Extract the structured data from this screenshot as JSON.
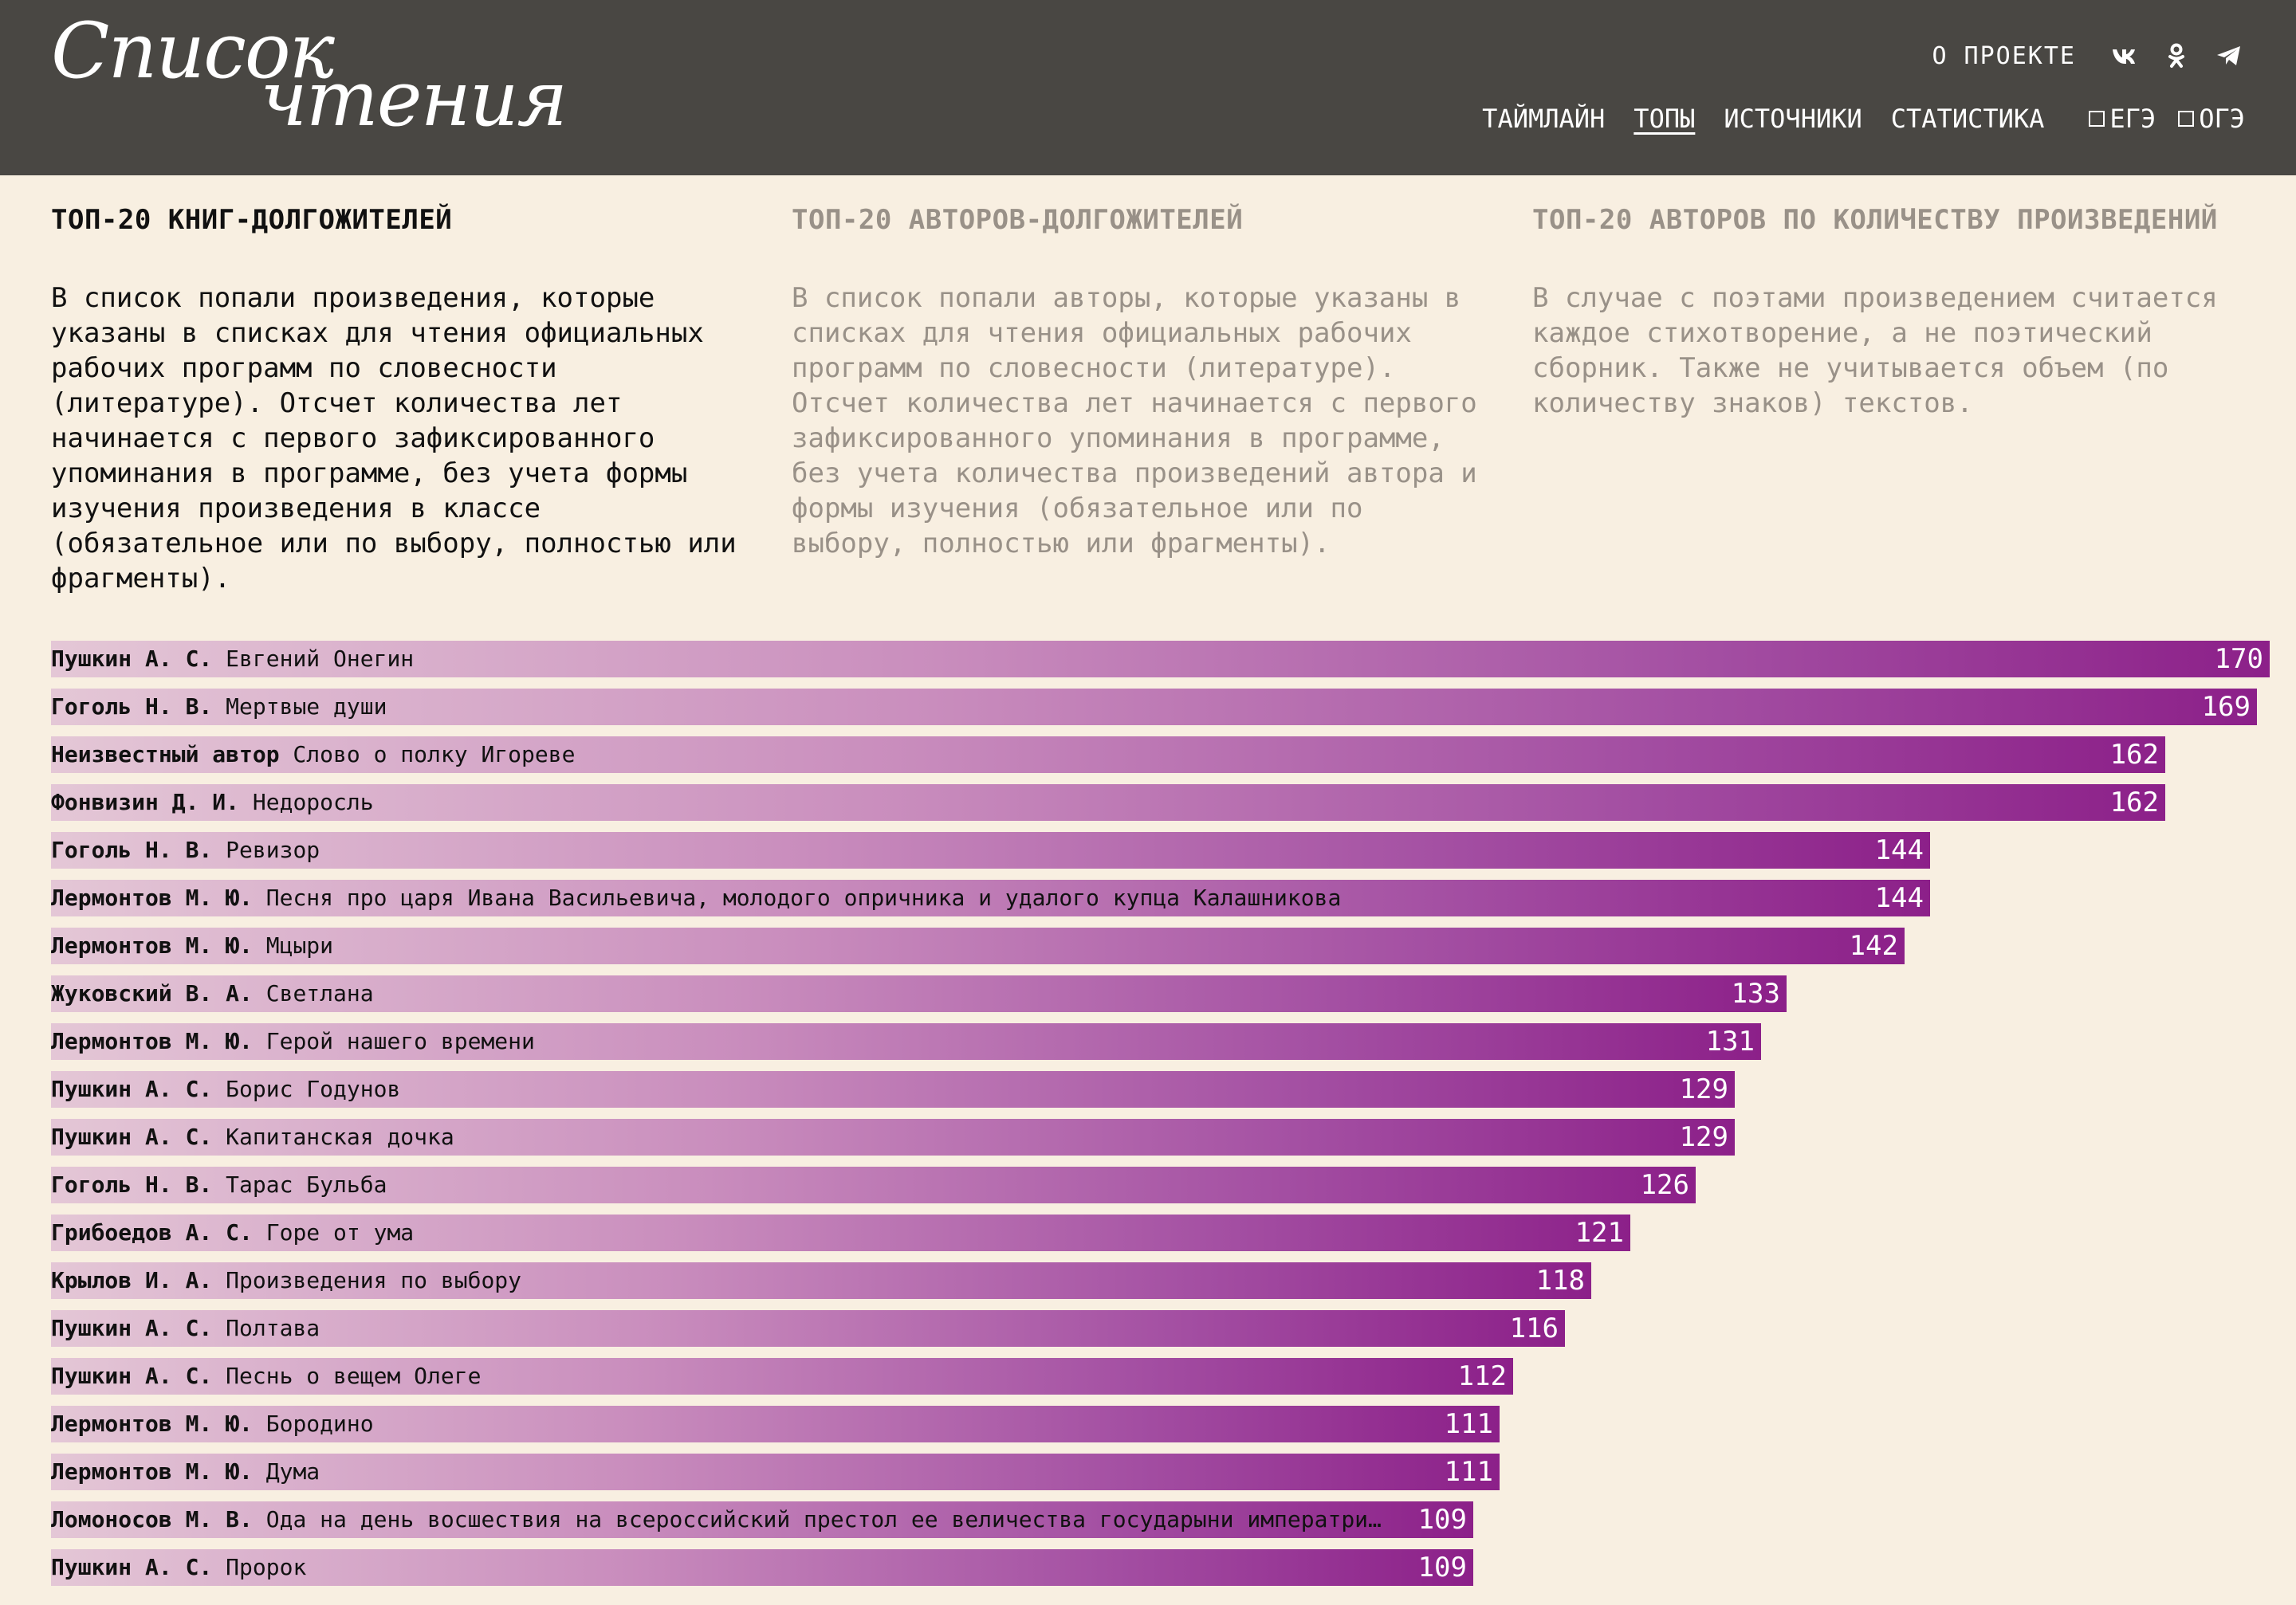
{
  "header": {
    "logo_line1": "Список",
    "logo_line2": "чтения",
    "about": "О ПРОЕКТЕ",
    "social": [
      "vk-icon",
      "ok-icon",
      "telegram-icon"
    ],
    "nav": [
      "ТАЙМЛАЙН",
      "ТОПЫ",
      "ИСТОЧНИКИ",
      "СТАТИСТИКА"
    ],
    "active_nav": "ТОПЫ",
    "filters": [
      "ЕГЭ",
      "ОГЭ"
    ]
  },
  "tabs": [
    {
      "title": "ТОП-20 КНИГ-ДОЛГОЖИТЕЛЕЙ",
      "text": "В список попали произведения, которые указаны в списках для чтения официальных рабочих программ по словесности (литературе). Отсчет количества лет начинается с первого зафиксированного упоминания в программе, без учета формы изучения произведения в классе (обязательное или по выбору, полностью или фрагменты).",
      "active": true
    },
    {
      "title": "ТОП-20 АВТОРОВ-ДОЛГОЖИТЕЛЕЙ",
      "text": "В список попали авторы, которые указаны в списках для чтения официальных рабочих программ по словесности (литературе). Отсчет количества лет начинается с первого зафиксированного упоминания в программе, без учета количества произведений автора и формы изучения (обязательное или по выбору, полностью или фрагменты).",
      "active": false
    },
    {
      "title": "ТОП-20 АВТОРОВ ПО КОЛИЧЕСТВУ ПРОИЗВЕДЕНИЙ",
      "text": "В случае с поэтами произведением считается каждое стихотворение, а не поэтический сборник. Также не учитывается объем (по количеству знаков) текстов.",
      "active": false
    }
  ],
  "chart_data": {
    "type": "bar",
    "orientation": "horizontal",
    "xlim": [
      0,
      170
    ],
    "colors": {
      "start": "#e4c7d6",
      "end": "#8c2089"
    },
    "rows": [
      {
        "author": "Пушкин А. С.",
        "title": "Евгений Онегин",
        "value": 170
      },
      {
        "author": "Гоголь Н. В.",
        "title": "Мертвые души",
        "value": 169
      },
      {
        "author": "Неизвестный автор",
        "title": "Слово о полку Игореве",
        "value": 162
      },
      {
        "author": "Фонвизин Д. И.",
        "title": "Недоросль",
        "value": 162
      },
      {
        "author": "Гоголь Н. В.",
        "title": "Ревизор",
        "value": 144
      },
      {
        "author": "Лермонтов М. Ю.",
        "title": "Песня про царя Ивана Васильевича, молодого опричника и удалого купца Калашникова",
        "value": 144
      },
      {
        "author": "Лермонтов М. Ю.",
        "title": "Мцыри",
        "value": 142
      },
      {
        "author": "Жуковский В. А.",
        "title": "Светлана",
        "value": 133
      },
      {
        "author": "Лермонтов М. Ю.",
        "title": "Герой нашего времени",
        "value": 131
      },
      {
        "author": "Пушкин А. С.",
        "title": "Борис Годунов",
        "value": 129
      },
      {
        "author": "Пушкин А. С.",
        "title": "Капитанская дочка",
        "value": 129
      },
      {
        "author": "Гоголь Н. В.",
        "title": "Тарас Бульба",
        "value": 126
      },
      {
        "author": "Грибоедов А. С.",
        "title": "Горе от ума",
        "value": 121
      },
      {
        "author": "Крылов И. А.",
        "title": "Произведения по выбору",
        "value": 118
      },
      {
        "author": "Пушкин А. С.",
        "title": "Полтава",
        "value": 116
      },
      {
        "author": "Пушкин А. С.",
        "title": "Песнь о вещем Олеге",
        "value": 112
      },
      {
        "author": "Лермонтов М. Ю.",
        "title": "Бородино",
        "value": 111
      },
      {
        "author": "Лермонтов М. Ю.",
        "title": "Дума",
        "value": 111
      },
      {
        "author": "Ломоносов М. В.",
        "title": "Ода на день восшествия на всероссийский престол ее величества государыни императриц…",
        "value": 109
      },
      {
        "author": "Пушкин А. С.",
        "title": "Пророк",
        "value": 109
      }
    ]
  }
}
